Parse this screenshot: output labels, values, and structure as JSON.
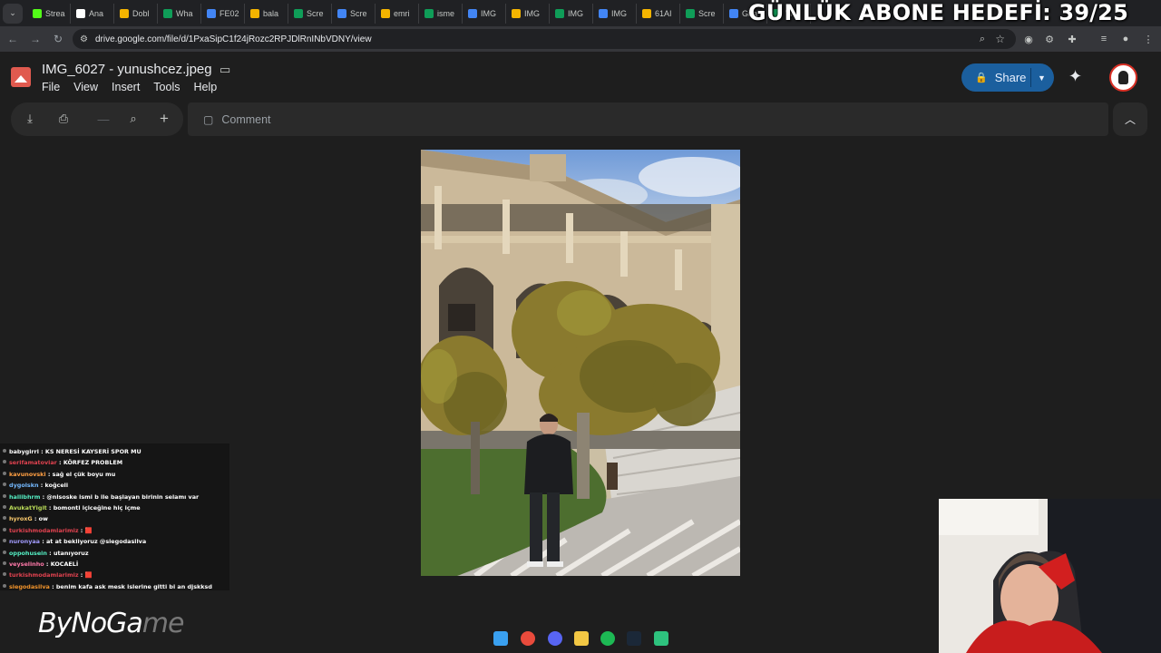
{
  "overlay": {
    "goal_text": "GÜNLÜK ABONE HEDEFİ: 39/25"
  },
  "browser": {
    "tabs": [
      {
        "label": "Strea",
        "favicon_color": "#53fc18"
      },
      {
        "label": "Ana",
        "favicon_color": "#ffffff"
      },
      {
        "label": "Dobl",
        "favicon_color": "#f4b400"
      },
      {
        "label": "Wha",
        "favicon_color": "#0f9d58"
      },
      {
        "label": "FE02",
        "favicon_color": "#4285f4"
      },
      {
        "label": "bala",
        "favicon_color": "#f4b400"
      },
      {
        "label": "Scre",
        "favicon_color": "#0f9d58"
      },
      {
        "label": "Scre",
        "favicon_color": "#4285f4"
      },
      {
        "label": "emri",
        "favicon_color": "#f4b400"
      },
      {
        "label": "isme",
        "favicon_color": "#0f9d58"
      },
      {
        "label": "IMG",
        "favicon_color": "#4285f4"
      },
      {
        "label": "IMG",
        "favicon_color": "#f4b400"
      },
      {
        "label": "IMG",
        "favicon_color": "#0f9d58"
      },
      {
        "label": "IMG",
        "favicon_color": "#4285f4"
      },
      {
        "label": "61AI",
        "favicon_color": "#f4b400"
      },
      {
        "label": "Scre",
        "favicon_color": "#0f9d58"
      },
      {
        "label": "Gira",
        "favicon_color": "#4285f4"
      },
      {
        "label": "W",
        "favicon_color": "#0f9d58"
      }
    ],
    "url": "drive.google.com/file/d/1PxaSipC1f24jRozc2RPJDlRnINbVDNY/view"
  },
  "viewer": {
    "file_title": "IMG_6027 - yunushcez.jpeg",
    "menu": [
      "File",
      "View",
      "Insert",
      "Tools",
      "Help"
    ],
    "share_label": "Share",
    "comment_label": "Comment"
  },
  "chat": [
    {
      "user": "babygirrl",
      "user_color": "#ffffff",
      "msg": "KS NERESİ KAYSERİ SPOR MU"
    },
    {
      "user": "serifamatoviar",
      "user_color": "#e0424f",
      "msg": "KÖRFEZ PROBLEM"
    },
    {
      "user": "kavunovski",
      "user_color": "#ff9f43",
      "msg": "sağ el çük boyu mu"
    },
    {
      "user": "dygolskn",
      "user_color": "#74b9ff",
      "msg": "koğceli"
    },
    {
      "user": "hallibhrm",
      "user_color": "#55efc4",
      "msg": "@nisoske ismi b ile başlayan birinin selamı var"
    },
    {
      "user": "AvukatYigit",
      "user_color": "#badc58",
      "msg": "bomonti içiceğine hiç içme"
    },
    {
      "user": "hyroxG",
      "user_color": "#fdcb6e",
      "msg": "ow"
    },
    {
      "user": "turkishmodamlarimiz",
      "user_color": "#e0424f",
      "msg": "🟥"
    },
    {
      "user": "nuronyaa",
      "user_color": "#a29bfe",
      "msg": "at at bekliyoruz @siegodasilva"
    },
    {
      "user": "oppohusein",
      "user_color": "#55efc4",
      "msg": "utanıyoruz"
    },
    {
      "user": "veyselinho",
      "user_color": "#fd79a8",
      "msg": "KOCAELİ"
    },
    {
      "user": "turkishmodamlarimiz",
      "user_color": "#e0424f",
      "msg": "🟥"
    },
    {
      "user": "siegodasilva",
      "user_color": "#f0932b",
      "msg": "benim kafa ask mesk islerine gitti bi an djskksd"
    }
  ],
  "logo": {
    "main": "ByNoGa",
    "faint": "me"
  }
}
